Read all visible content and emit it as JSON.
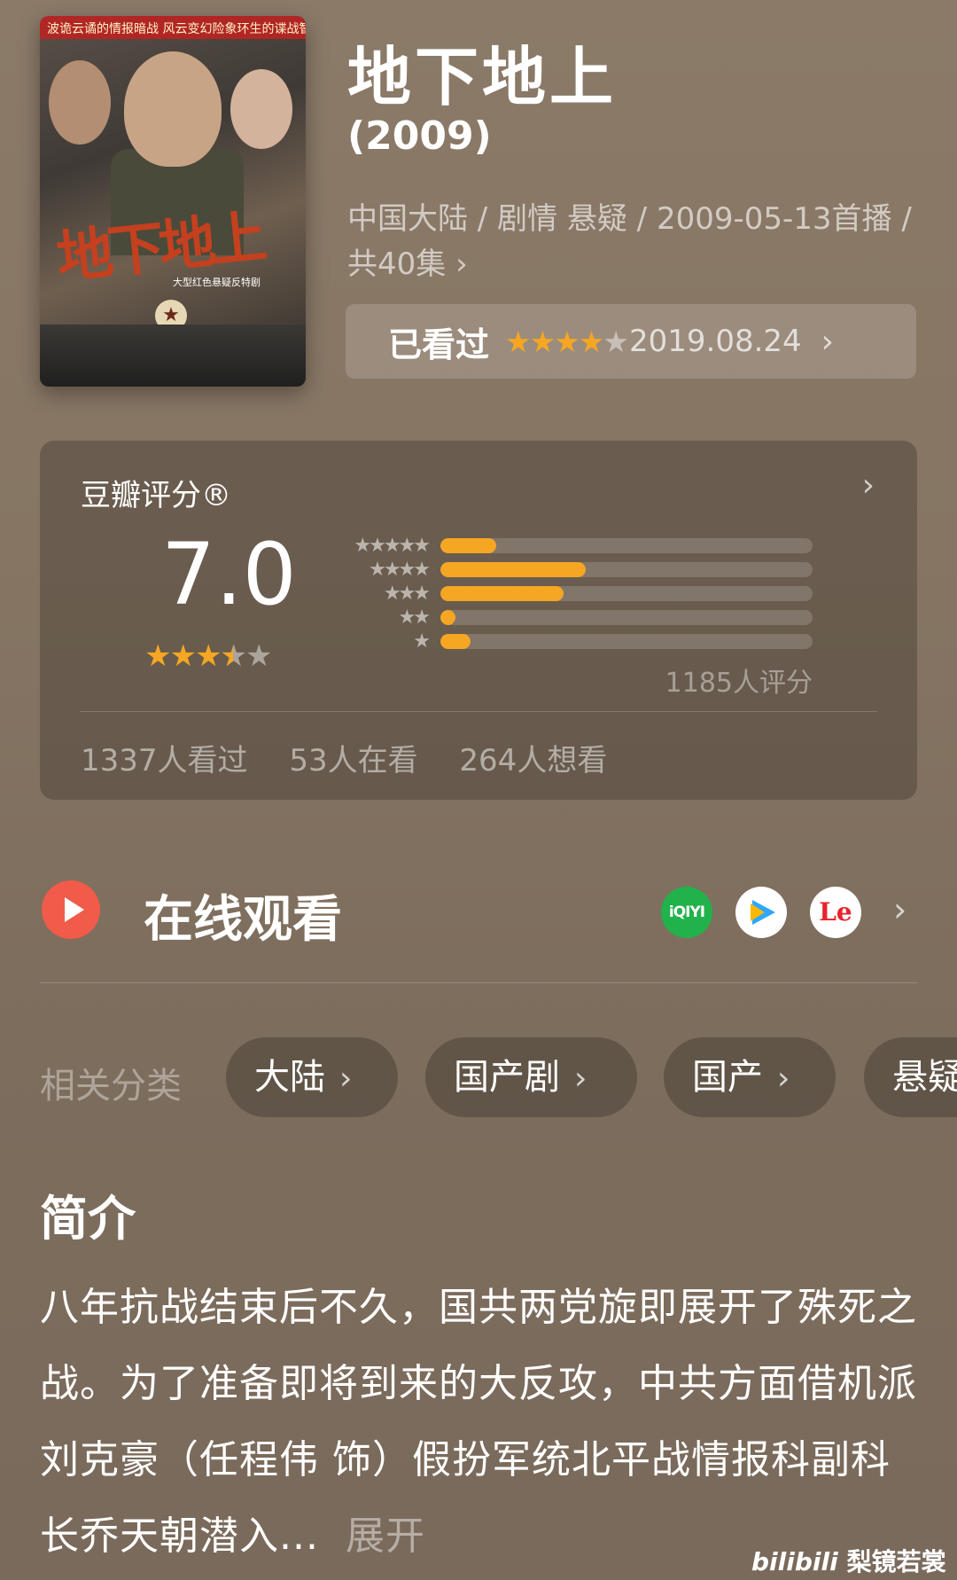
{
  "movie": {
    "title": "地下地上",
    "year": "(2009)",
    "meta": "中国大陆 / 剧情 悬疑 / 2009-05-13首播 / 共40集",
    "poster": {
      "top_band": "波诡云谲的情报暗战  风云变幻险象环生的谍战智斗",
      "logo": "地下地上",
      "subtitle": "大型红色悬疑反特剧"
    }
  },
  "watched": {
    "label": "已看过",
    "user_rating_stars": 4,
    "date": "2019.08.24"
  },
  "rating": {
    "header": "豆瓣评分®",
    "score": "7.0",
    "stars": 3.5,
    "distribution": [
      {
        "stars": "★★★★★",
        "fraction": 0.15
      },
      {
        "stars": "★★★★",
        "fraction": 0.39
      },
      {
        "stars": "★★★",
        "fraction": 0.33
      },
      {
        "stars": "★★",
        "fraction": 0.04
      },
      {
        "stars": "★",
        "fraction": 0.08
      }
    ],
    "count": "1185人评分",
    "stats": {
      "watched": "1337人看过",
      "watching": "53人在看",
      "want": "264人想看"
    }
  },
  "online": {
    "label": "在线观看",
    "platforms": [
      "iqiyi-icon",
      "tencent-video-icon",
      "letv-icon"
    ],
    "iqiyi_text": "iQIYI",
    "le_text": "Le"
  },
  "categories": {
    "label": "相关分类",
    "chips": [
      "大陆",
      "国产剧",
      "国产",
      "悬疑"
    ]
  },
  "intro": {
    "heading": "简介",
    "text": "八年抗战结束后不久，国共两党旋即展开了殊死之战。为了准备即将到来的大反攻，中共方面借机派刘克豪（任程伟 饰）假扮军统北平战情报科副科长乔天朝潜入...",
    "expand": "展开"
  },
  "watermark": {
    "brand": "bilibili",
    "user": "梨镜若裳"
  },
  "colors": {
    "accent": "#f5a623",
    "play": "#f15b4a",
    "iqiyi": "#21b24b"
  }
}
